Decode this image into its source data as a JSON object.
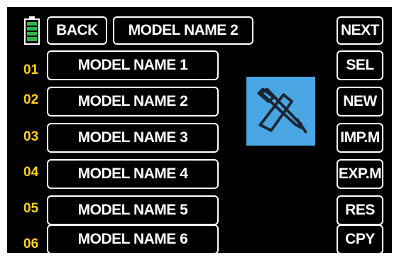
{
  "header": {
    "back_label": "BACK",
    "current_model": "MODEL NAME 2"
  },
  "models": [
    {
      "number": "01",
      "name": "MODEL NAME 1"
    },
    {
      "number": "02",
      "name": "MODEL NAME 2"
    },
    {
      "number": "03",
      "name": "MODEL NAME 3"
    },
    {
      "number": "04",
      "name": "MODEL NAME 4"
    },
    {
      "number": "05",
      "name": "MODEL NAME 5"
    },
    {
      "number": "06",
      "name": "MODEL NAME 6"
    }
  ],
  "side_buttons": [
    "NEXT",
    "SEL",
    "NEW",
    "IMP.M",
    "EXP.M",
    "RES",
    "CPY"
  ],
  "colors": {
    "background": "#000000",
    "number_text": "#ffd21a",
    "battery": "#35b44a",
    "preview_bg": "#4aa6e3"
  },
  "icons": {
    "battery": "battery-full-icon",
    "preview": "airplane-icon"
  }
}
